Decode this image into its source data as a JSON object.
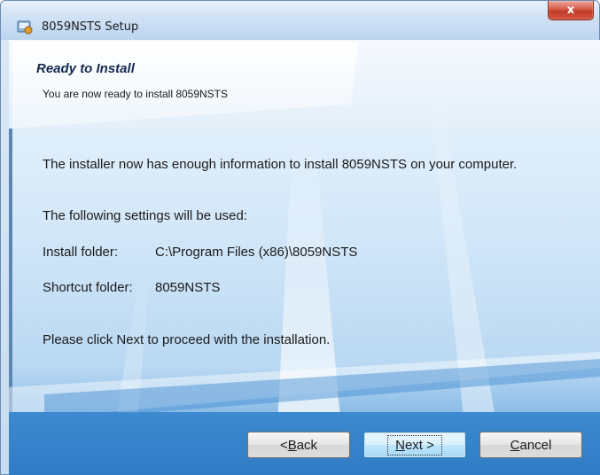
{
  "window": {
    "title": "8059NSTS Setup",
    "close_label": "x"
  },
  "header": {
    "title": "Ready to Install",
    "subtitle": "You are now ready to install 8059NSTS"
  },
  "body": {
    "intro": "The installer now has enough information to install 8059NSTS on your computer.",
    "settings_heading": "The following settings will be used:",
    "install_folder_label": "Install folder:",
    "install_folder_value": "C:\\Program Files (x86)\\8059NSTS",
    "shortcut_folder_label": "Shortcut folder:",
    "shortcut_folder_value": "8059NSTS",
    "instruction": "Please click Next to proceed with the installation."
  },
  "buttons": {
    "back": {
      "prefix": "< ",
      "accel": "B",
      "rest": "ack"
    },
    "next": {
      "accel": "N",
      "rest": "ext >"
    },
    "cancel": {
      "accel": "C",
      "rest": "ancel"
    }
  },
  "colors": {
    "accent": "#2f7cc6",
    "close_button": "#c23b2a",
    "title_text": "#13294f"
  }
}
